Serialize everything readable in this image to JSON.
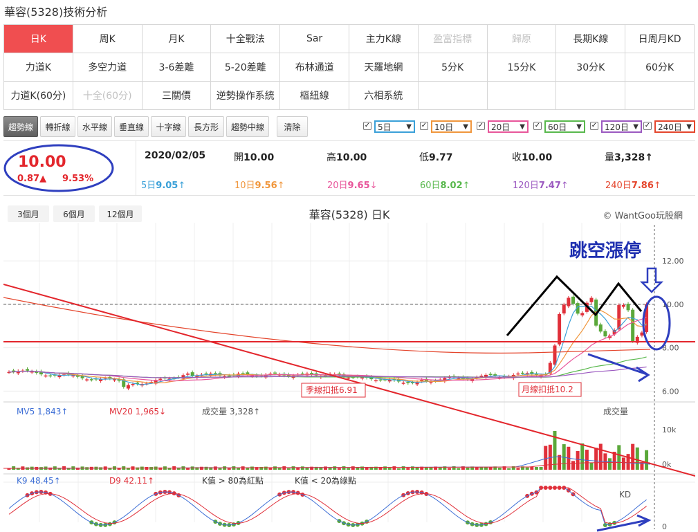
{
  "page_title": "華容(5328)技術分析",
  "tabs": [
    {
      "label": "日K",
      "state": "active"
    },
    {
      "label": "周K",
      "state": ""
    },
    {
      "label": "月K",
      "state": ""
    },
    {
      "label": "十全戰法",
      "state": ""
    },
    {
      "label": "Sar",
      "state": ""
    },
    {
      "label": "主力K線",
      "state": ""
    },
    {
      "label": "盈富指標",
      "state": "disabled"
    },
    {
      "label": "歸原",
      "state": "disabled"
    },
    {
      "label": "長期K線",
      "state": ""
    },
    {
      "label": "日周月KD",
      "state": ""
    },
    {
      "label": "力道K",
      "state": ""
    },
    {
      "label": "多空力道",
      "state": ""
    },
    {
      "label": "3-6差離",
      "state": ""
    },
    {
      "label": "5-20差離",
      "state": ""
    },
    {
      "label": "布林通道",
      "state": ""
    },
    {
      "label": "天羅地網",
      "state": ""
    },
    {
      "label": "5分K",
      "state": ""
    },
    {
      "label": "15分K",
      "state": ""
    },
    {
      "label": "30分K",
      "state": ""
    },
    {
      "label": "60分K",
      "state": ""
    },
    {
      "label": "力道K(60分)",
      "state": ""
    },
    {
      "label": "十全(60分)",
      "state": "disabled"
    },
    {
      "label": "三關價",
      "state": ""
    },
    {
      "label": "逆勢操作系統",
      "state": ""
    },
    {
      "label": "樞紐線",
      "state": ""
    },
    {
      "label": "六相系統",
      "state": ""
    }
  ],
  "toolbar": {
    "tools": [
      "趨勢線",
      "轉折線",
      "水平線",
      "垂直線",
      "十字線",
      "長方形",
      "趨勢中線"
    ],
    "clear_label": "清除",
    "ma_selectors": [
      {
        "label": "5日",
        "color": "#3aa0d8"
      },
      {
        "label": "10日",
        "color": "#f0963c"
      },
      {
        "label": "20日",
        "color": "#e8559a"
      },
      {
        "label": "60日",
        "color": "#58b84c"
      },
      {
        "label": "120日",
        "color": "#9b59c0"
      },
      {
        "label": "240日",
        "color": "#e4452c"
      }
    ]
  },
  "quote": {
    "price": "10.00",
    "change": "0.87▲",
    "change_pct": "9.53%",
    "date": "2020/02/05",
    "open_label": "開",
    "open": "10.00",
    "high_label": "高",
    "high": "10.00",
    "low_label": "低",
    "low": "9.77",
    "close_label": "收",
    "close": "10.00",
    "volume_label": "量",
    "volume": "3,328↑",
    "ma_values": [
      {
        "label": "5日",
        "value": "9.05",
        "arrow": "↑",
        "color": "#3aa0d8"
      },
      {
        "label": "10日",
        "value": "9.56",
        "arrow": "↑",
        "color": "#f0963c"
      },
      {
        "label": "20日",
        "value": "9.65",
        "arrow": "↓",
        "color": "#e8559a"
      },
      {
        "label": "60日",
        "value": "8.02",
        "arrow": "↑",
        "color": "#58b84c"
      },
      {
        "label": "120日",
        "value": "7.47",
        "arrow": "↑",
        "color": "#9b59c0"
      },
      {
        "label": "240日",
        "value": "7.86",
        "arrow": "↑",
        "color": "#e4452c"
      }
    ]
  },
  "chart": {
    "ranges": [
      "3個月",
      "6個月",
      "12個月"
    ],
    "title": "華容(5328) 日K",
    "credit": "© WantGoo玩股網",
    "annotation_text": "跳空漲停",
    "season_label": "季線扣抵6.91",
    "month_label": "月線扣抵10.2",
    "volume_panel_label": "成交量",
    "kd_panel_label": "KD",
    "vol_legend": [
      {
        "text": "MV5 1,843↑",
        "color": "#3e6fd6"
      },
      {
        "text": "MV20 1,965↓",
        "color": "#e0303a"
      },
      {
        "text": "成交量 3,328↑",
        "color": "#555"
      }
    ],
    "kd_legend": [
      {
        "text": "K9 48.45↑",
        "color": "#3e6fd6"
      },
      {
        "text": "D9 42.11↑",
        "color": "#e0303a"
      },
      {
        "text": "K值 > 80為紅點",
        "color": "#333"
      },
      {
        "text": "K值 < 20為綠點",
        "color": "#333"
      }
    ],
    "price_ticks": [
      "12.00",
      "10.00",
      "8.00",
      "6.00"
    ],
    "volume_ticks": [
      "10k",
      "0k"
    ],
    "kd_ticks": [
      "0"
    ]
  },
  "chart_data": {
    "type": "candlestick",
    "title": "華容(5328) 日K",
    "ylim": [
      5.5,
      13.5
    ],
    "y_ticks": [
      6,
      8,
      10,
      12
    ],
    "last_bar": {
      "date": "2020/02/05",
      "open": 10.0,
      "high": 10.0,
      "low": 9.77,
      "close": 10.0,
      "volume": 3328
    },
    "annotations": [
      "跳空漲停",
      "季線扣抵6.91",
      "月線扣抵10.2"
    ],
    "volume_ticks": [
      "10k",
      "0k"
    ],
    "kd": {
      "k9": 48.45,
      "d9": 42.11
    }
  }
}
